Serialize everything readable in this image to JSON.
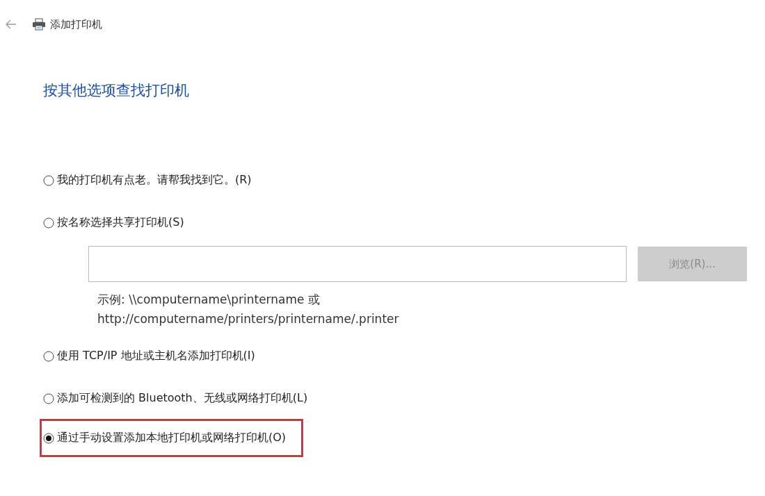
{
  "header": {
    "title": "添加打印机"
  },
  "heading": "按其他选项查找打印机",
  "options": [
    {
      "label": "我的打印机有点老。请帮我找到它。(R)",
      "selected": false,
      "highlighted": false
    },
    {
      "label": "按名称选择共享打印机(S)",
      "selected": false,
      "highlighted": false,
      "browse_button": {
        "label": "浏览(R)...",
        "disabled": true
      },
      "example": [
        "示例: \\\\computername\\printername 或",
        "http://computername/printers/printername/.printer"
      ]
    },
    {
      "label": "使用 TCP/IP 地址或主机名添加打印机(I)",
      "selected": false,
      "highlighted": false
    },
    {
      "label": "添加可检测到的 Bluetooth、无线或网络打印机(L)",
      "selected": false,
      "highlighted": false
    },
    {
      "label": "通过手动设置添加本地打印机或网络打印机(O)",
      "selected": true,
      "highlighted": true
    }
  ]
}
